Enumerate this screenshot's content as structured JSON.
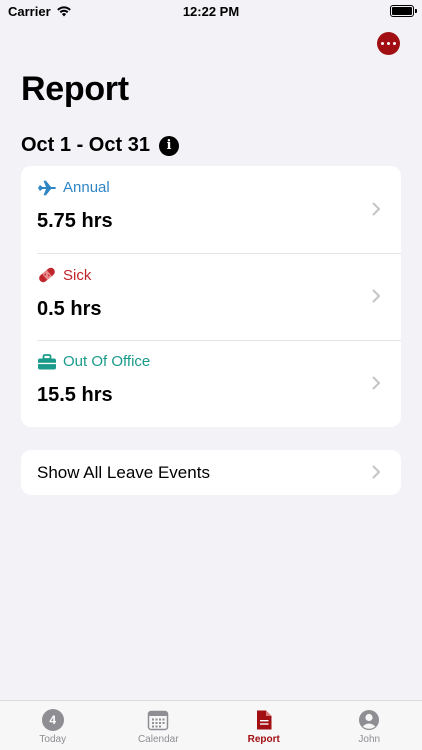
{
  "status_bar": {
    "carrier": "Carrier",
    "time": "12:22 PM"
  },
  "header": {
    "more_icon": "ellipsis-circle-icon",
    "title": "Report"
  },
  "report": {
    "date_range": "Oct 1 - Oct 31",
    "info_icon": "info-circle-icon",
    "leave_items": [
      {
        "type": "Annual",
        "hours": "5.75 hrs",
        "icon": "airplane-icon",
        "color": "#2f86c4"
      },
      {
        "type": "Sick",
        "hours": "0.5 hrs",
        "icon": "bandage-icon",
        "color": "#c0262c"
      },
      {
        "type": "Out Of Office",
        "hours": "15.5 hrs",
        "icon": "briefcase-icon",
        "color": "#1a9a8a"
      }
    ],
    "show_all_label": "Show All Leave Events"
  },
  "tab_bar": {
    "tabs": [
      {
        "label": "Today",
        "badge": "4",
        "icon": "today-badge-icon",
        "active": false
      },
      {
        "label": "Calendar",
        "icon": "calendar-icon",
        "active": false
      },
      {
        "label": "Report",
        "icon": "document-icon",
        "active": true
      },
      {
        "label": "John",
        "icon": "person-circle-icon",
        "active": false
      }
    ],
    "accent": "#a10f12"
  }
}
